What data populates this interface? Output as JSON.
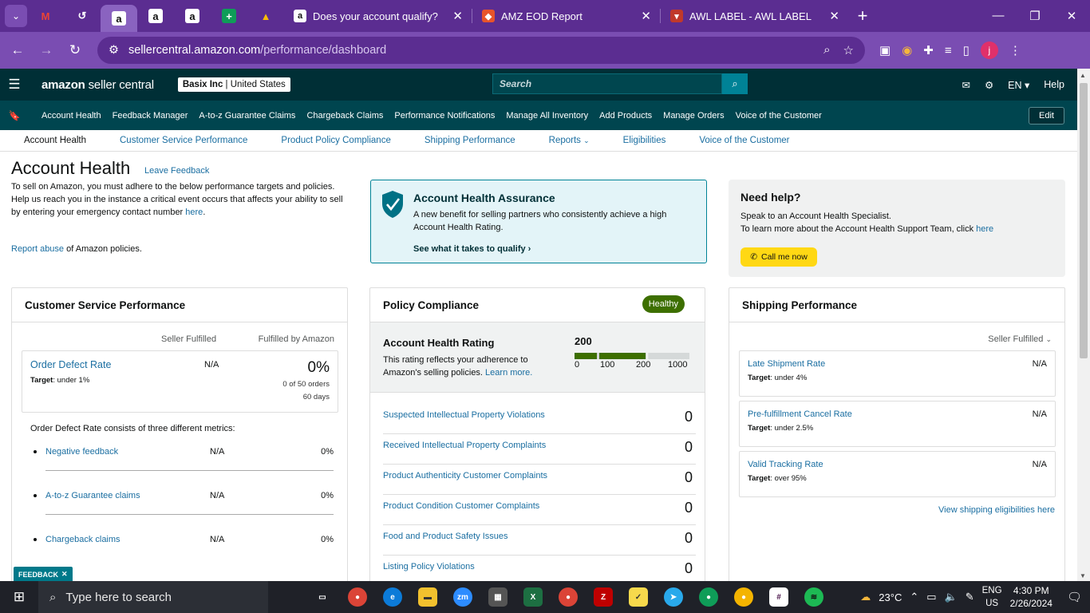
{
  "browser": {
    "tabs": [
      {
        "title": "Does your account qualify?"
      },
      {
        "title": "AMZ EOD Report"
      },
      {
        "title": "AWL LABEL - AWL LABEL"
      }
    ],
    "url_host": "sellercentral.amazon.com",
    "url_path": "/performance/dashboard"
  },
  "header": {
    "logo_brand": "amazon",
    "logo_suffix": " seller central",
    "account_name": "Basix Inc",
    "account_region": "United States",
    "search_placeholder": "Search",
    "language": "EN",
    "help": "Help"
  },
  "nav": {
    "links": [
      "Account Health",
      "Feedback Manager",
      "A-to-z Guarantee Claims",
      "Chargeback Claims",
      "Performance Notifications",
      "Manage All Inventory",
      "Add Products",
      "Manage Orders",
      "Voice of the Customer"
    ],
    "edit": "Edit"
  },
  "subnav": [
    "Account Health",
    "Customer Service Performance",
    "Product Policy Compliance",
    "Shipping Performance",
    "Reports",
    "Eligibilities",
    "Voice of the Customer"
  ],
  "page": {
    "title": "Account Health",
    "leave_feedback": "Leave Feedback",
    "intro1": "To sell on Amazon, you must adhere to the below performance targets and policies.",
    "intro2_pre": "Help us reach you in the instance a critical event occurs that affects your ability to sell by entering your emergency contact number ",
    "intro2_link": "here",
    "intro2_post": ".",
    "report_abuse_link": "Report abuse",
    "report_abuse_post": " of Amazon policies."
  },
  "assurance": {
    "title": "Account Health Assurance",
    "text": "A new benefit for selling partners who consistently achieve a high Account Health Rating.",
    "link": "See what it takes to qualify"
  },
  "help": {
    "title": "Need help?",
    "line1": "Speak to an Account Health Specialist.",
    "line2_pre": "To learn more about the Account Health Support Team, click ",
    "line2_link": "here",
    "call": "Call me now"
  },
  "csp": {
    "title": "Customer Service Performance",
    "col_seller": "Seller Fulfilled",
    "col_fba": "Fulfilled by Amazon",
    "odr_name": "Order Defect Rate",
    "odr_target_label": "Target",
    "odr_target": ": under 1%",
    "odr_seller": "N/A",
    "odr_fba": "0%",
    "odr_orders": "0 of 50 orders",
    "odr_days": "60 days",
    "desc": "Order Defect Rate consists of three different metrics:",
    "metrics": [
      {
        "name": "Negative feedback",
        "seller": "N/A",
        "fba": "0%"
      },
      {
        "name": "A-to-z Guarantee claims",
        "seller": "N/A",
        "fba": "0%"
      },
      {
        "name": "Chargeback claims",
        "seller": "N/A",
        "fba": "0%"
      }
    ]
  },
  "policy": {
    "title": "Policy Compliance",
    "badge": "Healthy",
    "ahr_title": "Account Health Rating",
    "ahr_text_pre": "This rating reflects your adherence to Amazon's selling policies. ",
    "ahr_link": "Learn more.",
    "score": "200",
    "score_fraction": 0.62,
    "ticks": [
      "0",
      "100",
      "200",
      "1000"
    ],
    "violations": [
      {
        "name": "Suspected Intellectual Property Violations",
        "count": "0"
      },
      {
        "name": "Received Intellectual Property Complaints",
        "count": "0"
      },
      {
        "name": "Product Authenticity Customer Complaints",
        "count": "0"
      },
      {
        "name": "Product Condition Customer Complaints",
        "count": "0"
      },
      {
        "name": "Food and Product Safety Issues",
        "count": "0"
      },
      {
        "name": "Listing Policy Violations",
        "count": "0"
      }
    ]
  },
  "shipping": {
    "title": "Shipping Performance",
    "filter": "Seller Fulfilled",
    "target_label": "Target",
    "metrics": [
      {
        "name": "Late Shipment Rate",
        "target": ": under 4%",
        "value": "N/A"
      },
      {
        "name": "Pre-fulfillment Cancel Rate",
        "target": ": under 2.5%",
        "value": "N/A"
      },
      {
        "name": "Valid Tracking Rate",
        "target": ": over 95%",
        "value": "N/A"
      }
    ],
    "eligibility_link": "View shipping eligibilities here"
  },
  "feedback_tab": "FEEDBACK",
  "taskbar": {
    "search_placeholder": "Type here to search",
    "temperature": "23°C",
    "lang1": "ENG",
    "lang2": "US",
    "time": "4:30 PM",
    "date": "2/26/2024"
  }
}
